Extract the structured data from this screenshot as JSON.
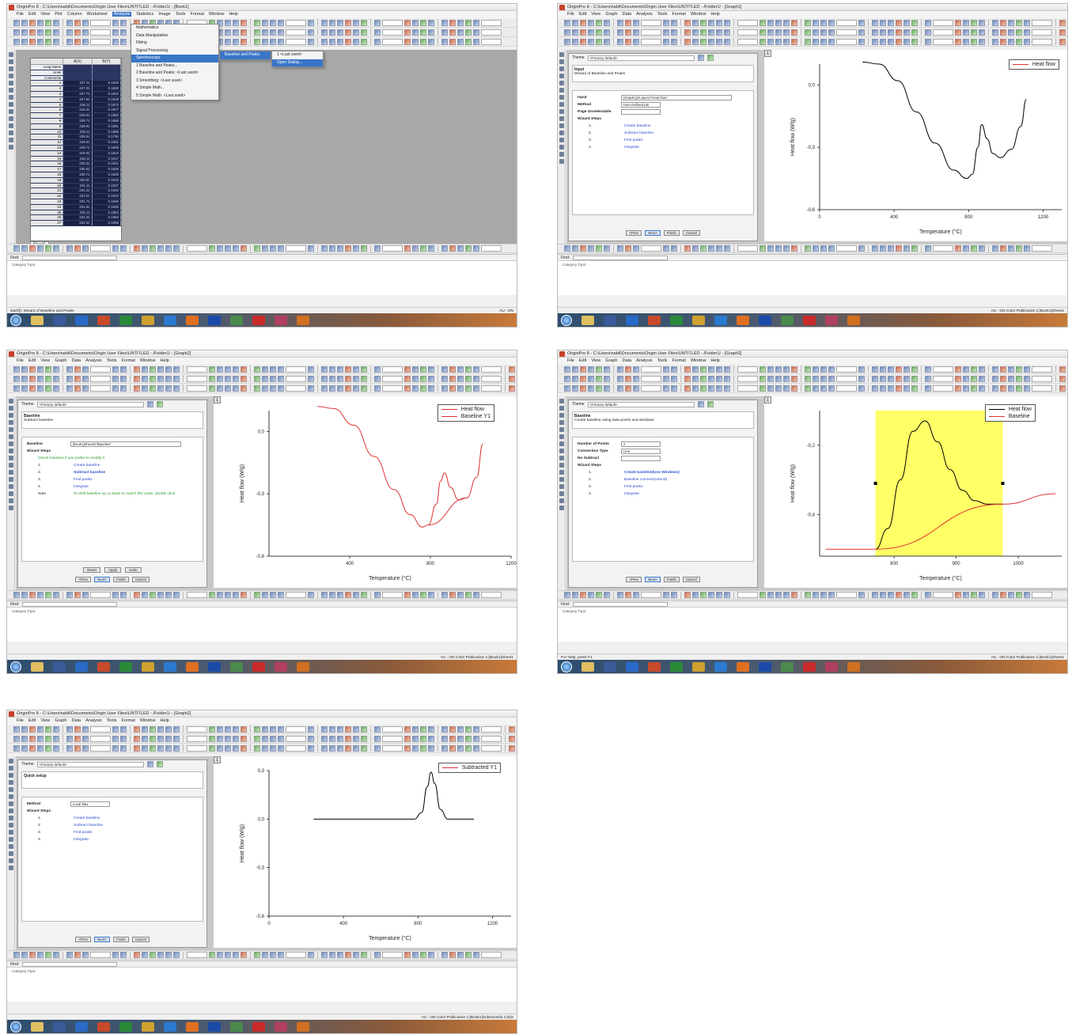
{
  "app": {
    "menu_items": [
      "File",
      "Edit",
      "View",
      "Plot",
      "Column",
      "Worksheet",
      "Analysis",
      "Statistics",
      "Image",
      "Tools",
      "Format",
      "Window",
      "Help"
    ],
    "menu_items_graph": [
      "File",
      "Edit",
      "View",
      "Graph",
      "Data",
      "Analysis",
      "Tools",
      "Format",
      "Window",
      "Help"
    ]
  },
  "shot1": {
    "title": "OriginPro 8 - C:\\Users\\nabil\\Documents\\Origin User Files\\UNTITLED - /Folder1/ - [Book1]",
    "grid_headers": [
      "",
      "A(X)",
      "B(Y)"
    ],
    "meta_rows": [
      "Long Name",
      "Units",
      "Comments"
    ],
    "rows": [
      [
        "1",
        "227.11",
        "0.1849"
      ],
      [
        "2",
        "227.31",
        "0.1830"
      ],
      [
        "3",
        "227.71",
        "0.1824"
      ],
      [
        "4",
        "227.91",
        "0.1818"
      ],
      [
        "5",
        "228.11",
        "0.1873"
      ],
      [
        "6",
        "228.31",
        "0.1877"
      ],
      [
        "7",
        "228.51",
        "0.1882"
      ],
      [
        "8",
        "228.71",
        "0.1888"
      ],
      [
        "9",
        "228.91",
        "0.1881"
      ],
      [
        "10",
        "229.11",
        "0.1886"
      ],
      [
        "11",
        "229.31",
        "0.1794"
      ],
      [
        "12",
        "229.51",
        "0.1801"
      ],
      [
        "13",
        "229.71",
        "0.1808"
      ],
      [
        "14",
        "229.91",
        "0.1813"
      ],
      [
        "15",
        "230.11",
        "0.1817"
      ],
      [
        "16",
        "230.31",
        "0.1921"
      ],
      [
        "17",
        "230.51",
        "0.1926"
      ],
      [
        "18",
        "230.71",
        "0.1929"
      ],
      [
        "19",
        "230.91",
        "0.1933"
      ],
      [
        "20",
        "231.11",
        "0.1937"
      ],
      [
        "21",
        "231.31",
        "0.1934"
      ],
      [
        "22",
        "231.51",
        "0.1943"
      ],
      [
        "23",
        "231.71",
        "0.1946"
      ],
      [
        "24",
        "231.91",
        "0.1940"
      ],
      [
        "25",
        "232.11",
        "0.1953"
      ],
      [
        "26",
        "232.31",
        "0.1954"
      ],
      [
        "27",
        "232.51",
        "0.1959"
      ]
    ],
    "sheet_tab": "Sheet1",
    "menu_analysis": [
      "Mathematics",
      "Data Manipulation",
      "Fitting",
      "Signal Processing",
      "Spectroscopy",
      "1 Baseline and Peaks...",
      "2 Baseline and Peaks: <Last used>",
      "3 Smoothing: <Last used>",
      "4 Simple Math...",
      "5 Simple Math: <Last used>"
    ],
    "menu_spectroscopy": [
      "Baseline and Peaks"
    ],
    "menu_baseline": [
      "1 <Last used>",
      "Open Dialog..."
    ],
    "status_left": "start(f): Wizard of Baseline and Peaks",
    "status_right": "AU : ON"
  },
  "shot2": {
    "title": "OriginPro 8 - C:\\Users\\nabil\\Documents\\Origin User Files\\UNTITLED - /Folder1/ - [Graph1]",
    "theme": "<Factory default>",
    "header_title": "Input",
    "header_desc": "Wizard of Baseline and Peaks",
    "fields": [
      {
        "k": "Input",
        "v": "[Graph1]1!Layer1!\"Heat flow\""
      },
      {
        "k": "Method",
        "v": "User Defined pts"
      },
      {
        "k": "Page Unselectable",
        "v": ""
      }
    ],
    "wizard_steps_label": "Wizard Steps",
    "steps": [
      {
        "n": "1.",
        "t": "Create baseline"
      },
      {
        "n": "2.",
        "t": "Subtract baseline"
      },
      {
        "n": "3.",
        "t": "Find peaks"
      },
      {
        "n": "4.",
        "t": "Integrate"
      }
    ],
    "buttons": [
      "<Prev",
      "Next>",
      "Finish",
      "Cancel"
    ],
    "legend": [
      "Heat flow"
    ],
    "status_right": "AU : ON    Color Publication    1:[Book1]Sheet1"
  },
  "shot3": {
    "title": "OriginPro 8 - C:\\Users\\nabil\\Documents\\Origin User Files\\UNTITLED - /Folder1/ - [Graph2]",
    "theme": "<Factory default>",
    "header_title": "Baseline",
    "header_desc": "Subtract baseline",
    "fields": [
      {
        "k": "Baseline",
        "v": "[Book1]Sheet1!\"Baseline\""
      }
    ],
    "wizard_steps_label": "Wizard Steps",
    "wizard_hint": "Check baseline if you prefer to modify it",
    "steps": [
      {
        "n": "1.",
        "t": "Create baseline"
      },
      {
        "n": "2.",
        "t": "Subtract baseline"
      },
      {
        "n": "3.",
        "t": "Find peaks"
      },
      {
        "n": "4.",
        "t": "Integrate"
      },
      {
        "n": "Note",
        "t": "To shift baseline up or down to match the curve, double click"
      }
    ],
    "extra_buttons": [
      "Reset",
      "Apply",
      "Undo"
    ],
    "buttons": [
      "<Prev",
      "Next>",
      "Finish",
      "Cancel"
    ],
    "legend": [
      "Heat flow",
      "Baseline Y1"
    ],
    "status_right": "AU : ON    Color Publication    1:[Book1]Sheet1"
  },
  "shot4": {
    "title": "OriginPro 8 - C:\\Users\\nabil\\Documents\\Origin User Files\\UNTITLED - /Folder1/ - [Graph2]",
    "theme": "<Factory default>",
    "header_title": "Baseline",
    "header_desc": "Create baseline using data points and windows",
    "fields": [
      {
        "k": "Number of Points",
        "v": "2"
      },
      {
        "k": "Connection Type",
        "v": "Line"
      },
      {
        "k": "No Subtract",
        "v": ""
      }
    ],
    "wizard_steps_label": "Wizard Steps",
    "steps": [
      {
        "n": "1.",
        "t": "Create baseline(Use Windows)"
      },
      {
        "n": "2.",
        "t": "Baseline connect(extend)"
      },
      {
        "n": "3.",
        "t": "Find peaks"
      },
      {
        "n": "4.",
        "t": "Integrate"
      }
    ],
    "buttons": [
      "<Prev",
      "Next>",
      "Finish",
      "Cancel"
    ],
    "legend": [
      "Heat flow",
      "Baseline"
    ],
    "status_left": "For Help, press F1",
    "status_right": "AU : ON    Color Publication    1:[Book1]Sheet1"
  },
  "shot5": {
    "title": "OriginPro 8 - C:\\Users\\nabil\\Documents\\Origin User Files\\UNTITLED - /Folder1/ - [Graph2]",
    "theme": "<Factory default>",
    "header_title": "Quick setup",
    "header_desc": "",
    "fields": [
      {
        "k": "Method",
        "v": "Local Max"
      }
    ],
    "wizard_steps_label": "Wizard Steps",
    "steps": [
      {
        "n": "1.",
        "t": "Create baseline"
      },
      {
        "n": "2.",
        "t": "Subtract baseline"
      },
      {
        "n": "3.",
        "t": "Find peaks"
      },
      {
        "n": "4.",
        "t": "Integrate"
      }
    ],
    "buttons": [
      "<Prev",
      "Next>",
      "Finish",
      "Cancel"
    ],
    "legend": [
      "Subtracted Y1"
    ],
    "status_right": "AU : ON    Color Publication    1:[Book1]Subtracted1 Col(S"
  },
  "common": {
    "find_label": "Find:",
    "find_cols": "Category    Topic",
    "xlabel": "Temperature (°C)",
    "ylabel": "Heat flow (W/g)"
  },
  "chart_data": [
    {
      "type": "line",
      "panel": "shot2",
      "xlabel": "Temperature (°C)",
      "ylabel": "Heat flow (W/g)",
      "xlim": [
        0,
        1300
      ],
      "ylim": [
        -0.6,
        0.1
      ],
      "xticks": [
        0,
        400,
        800,
        1200
      ],
      "yticks": [
        0.0,
        -0.3,
        -0.6
      ],
      "series": [
        {
          "name": "Heat flow",
          "color": "#000000",
          "x": [
            230,
            320,
            420,
            520,
            620,
            720,
            790,
            820,
            850,
            870,
            900,
            930,
            970,
            1030,
            1080,
            1110
          ],
          "y": [
            0.11,
            0.1,
            0.02,
            -0.13,
            -0.28,
            -0.41,
            -0.45,
            -0.43,
            -0.3,
            -0.19,
            -0.26,
            -0.33,
            -0.35,
            -0.31,
            -0.2,
            -0.07
          ]
        }
      ]
    },
    {
      "type": "line",
      "panel": "shot3",
      "xlabel": "Temperature (°C)",
      "ylabel": "Heat flow (W/g)",
      "xlim": [
        0,
        1200
      ],
      "ylim": [
        -0.6,
        0.1
      ],
      "xticks": [
        400,
        800,
        1200
      ],
      "yticks": [
        0.0,
        -0.3,
        -0.6
      ],
      "series": [
        {
          "name": "Heat flow",
          "color": "#e03030",
          "x": [
            240,
            320,
            420,
            520,
            620,
            700,
            760,
            790,
            830,
            850,
            870,
            900,
            940,
            980,
            1030,
            1060
          ],
          "y": [
            0.12,
            0.11,
            0.03,
            -0.12,
            -0.28,
            -0.4,
            -0.46,
            -0.45,
            -0.35,
            -0.24,
            -0.2,
            -0.27,
            -0.33,
            -0.32,
            -0.22,
            -0.06
          ]
        },
        {
          "name": "Baseline Y1",
          "color": "#e03030",
          "x": [
            790,
            980
          ],
          "y": [
            -0.45,
            -0.32
          ]
        }
      ]
    },
    {
      "type": "line",
      "panel": "shot4",
      "xlabel": "Temperature (°C)",
      "ylabel": "Heat flow (W/g)",
      "xlim": [
        680,
        1070
      ],
      "ylim": [
        -0.52,
        -0.1
      ],
      "xticks": [
        800,
        900,
        1000
      ],
      "yticks": [
        -0.2,
        -0.4
      ],
      "highlight_range": [
        770,
        975
      ],
      "series": [
        {
          "name": "Heat flow",
          "color": "#000000",
          "x": [
            770,
            790,
            810,
            830,
            850,
            870,
            890,
            910,
            930,
            950,
            975
          ],
          "y": [
            -0.5,
            -0.44,
            -0.3,
            -0.16,
            -0.13,
            -0.19,
            -0.27,
            -0.33,
            -0.36,
            -0.37,
            -0.37
          ]
        },
        {
          "name": "Baseline",
          "color": "#e03030",
          "x": [
            690,
            770,
            975,
            1060
          ],
          "y": [
            -0.5,
            -0.5,
            -0.37,
            -0.34
          ]
        }
      ]
    },
    {
      "type": "line",
      "panel": "shot5",
      "xlabel": "Temperature (°C)",
      "ylabel": "Heat flow (W/g)",
      "xlim": [
        0,
        1300
      ],
      "ylim": [
        -0.6,
        0.3
      ],
      "xticks": [
        0,
        400,
        800,
        1200
      ],
      "yticks": [
        0.3,
        0.0,
        -0.3,
        -0.6
      ],
      "series": [
        {
          "name": "Subtracted Y1",
          "color": "#000000",
          "x": [
            240,
            500,
            780,
            820,
            850,
            870,
            890,
            920,
            960,
            1100
          ],
          "y": [
            0.0,
            0.0,
            0.0,
            0.04,
            0.2,
            0.29,
            0.22,
            0.06,
            0.0,
            0.0
          ]
        }
      ]
    }
  ]
}
